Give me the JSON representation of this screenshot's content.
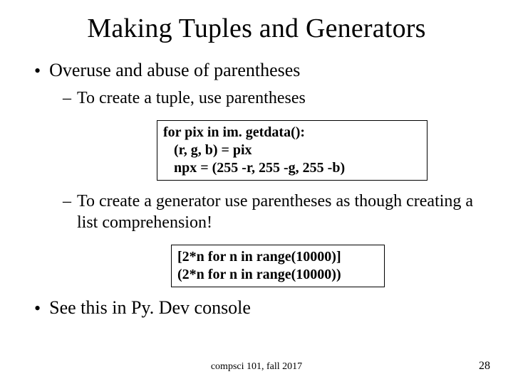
{
  "title": "Making Tuples and Generators",
  "bullets": {
    "b1": "Overuse and abuse of parentheses",
    "b1a": "To create a tuple, use parentheses",
    "b1b": "To create a generator use parentheses as though creating a list comprehension!",
    "b2": "See this in Py. Dev console"
  },
  "code1": {
    "l1": "for pix in im. getdata():",
    "l2": "   (r, g, b) = pix",
    "l3": "   npx = (255 -r, 255 -g, 255 -b)"
  },
  "code2": {
    "l1": "[2*n for n in range(10000)]",
    "l2": "(2*n for n in range(10000))"
  },
  "footer": {
    "center": "compsci 101, fall 2017",
    "page": "28"
  }
}
